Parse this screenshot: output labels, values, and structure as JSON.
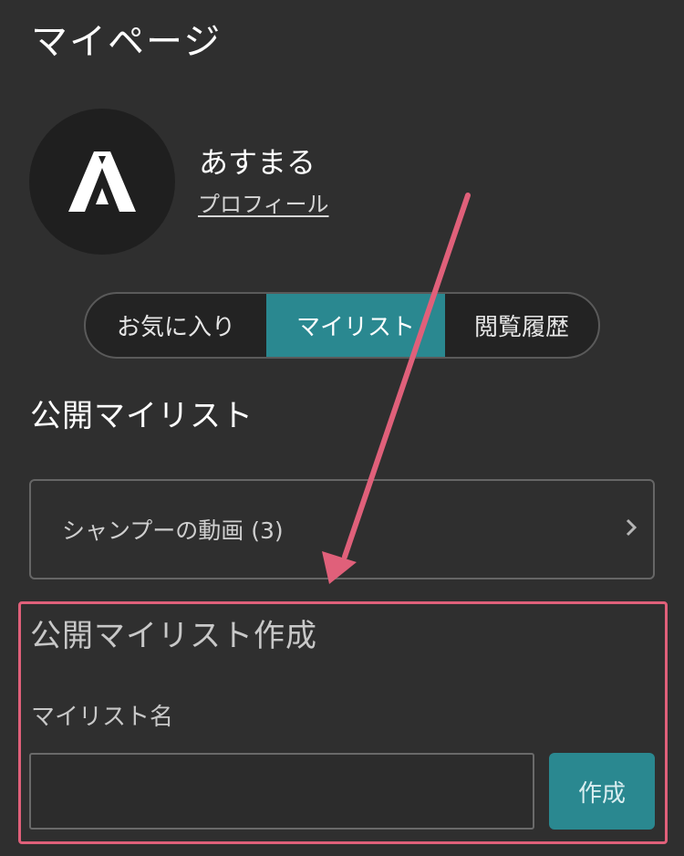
{
  "page": {
    "title": "マイページ"
  },
  "profile": {
    "username": "あすまる",
    "profile_link": "プロフィール",
    "avatar_icon": "letter-a-logo"
  },
  "tabs": [
    {
      "label": "お気に入り",
      "active": false
    },
    {
      "label": "マイリスト",
      "active": true
    },
    {
      "label": "閲覧履歴",
      "active": false
    }
  ],
  "public_mylist": {
    "title": "公開マイリスト",
    "items": [
      {
        "label": "シャンプーの動画 (3)",
        "icon": "chevron-right-icon"
      }
    ]
  },
  "create_mylist": {
    "title": "公開マイリスト作成",
    "field_label": "マイリスト名",
    "input_value": "",
    "button_label": "作成"
  },
  "colors": {
    "background": "#2f2f2f",
    "accent": "#2a8890",
    "annotation": "#e0607a"
  }
}
